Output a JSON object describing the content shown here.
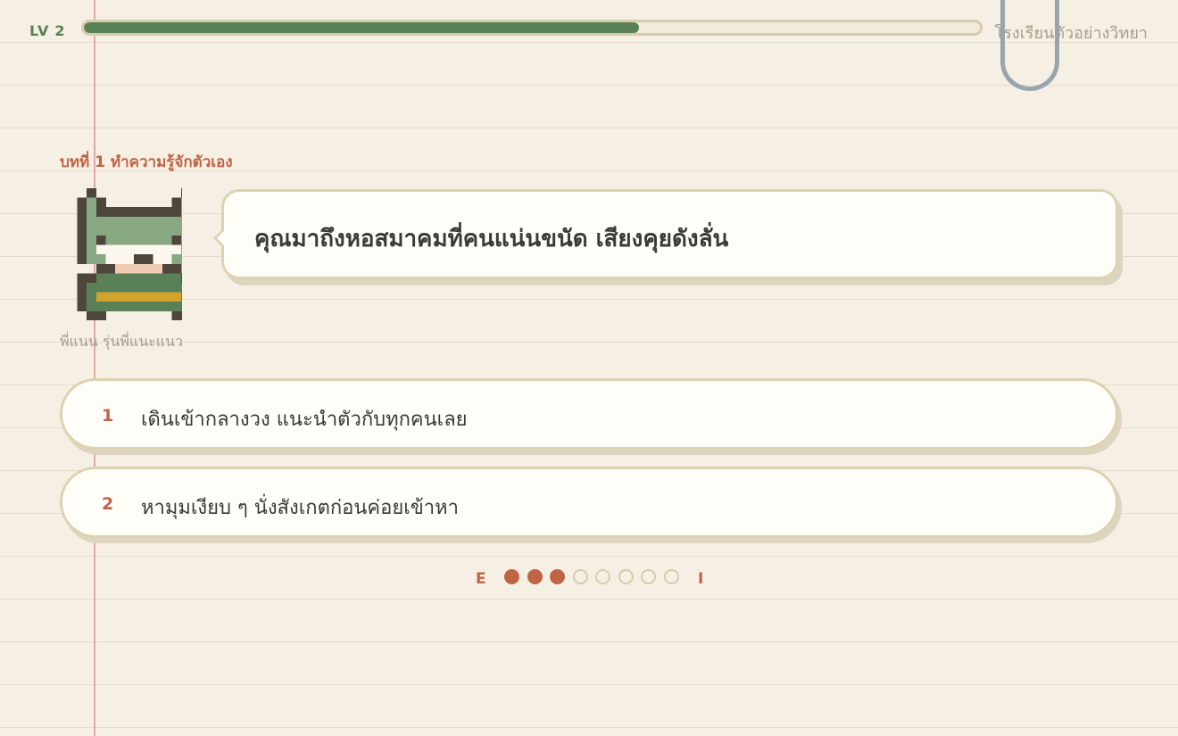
{
  "header": {
    "level_label": "LV",
    "level_value": "2",
    "progress": 0.62,
    "school_name": "โรงเรียนตัวอย่างวิทยา"
  },
  "chapter": {
    "title": "บทที่ 1 ทำความรู้จักตัวเอง"
  },
  "speaker": {
    "name": "พี่แนน รุ่นพี่แนะแนว",
    "message": "คุณมาถึงหอสมาคมที่คนแน่นขนัด เสียงคุยดังลั่น"
  },
  "choices": [
    {
      "number": "1",
      "text": "เดินเข้ากลางวง แนะนำตัวกับทุกคนเลย"
    },
    {
      "number": "2",
      "text": "หามุมเงียบ ๆ นั่งสังเกตก่อนค่อยเข้าหา"
    }
  ],
  "scale": {
    "left_label": "E",
    "right_label": "I",
    "total_steps": 8,
    "filled_steps": 3
  },
  "colors": {
    "accent": "#c06446",
    "green": "#5a8058",
    "paper": "#f6efe4",
    "card": "#fefdf7",
    "border": "#ddd2b2",
    "clip": "#97a6ad"
  },
  "icons": {
    "avatar": "pixel-character-avatar",
    "clip": "paper-clip-icon"
  }
}
